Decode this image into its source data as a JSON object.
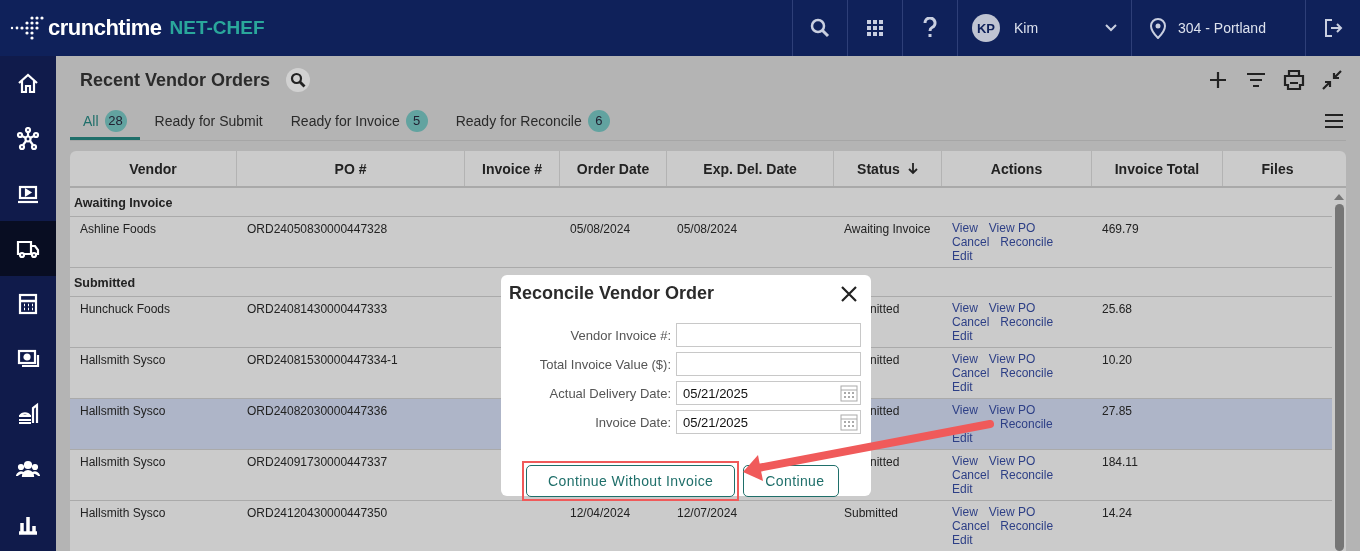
{
  "top_bar": {
    "logo": {
      "brand": "crunchtime",
      "product": "NET-CHEF"
    },
    "user": {
      "initials": "KP",
      "name": "Kim"
    },
    "location": "304 - Portland"
  },
  "sidebar": {
    "items": [
      {
        "kind": "home",
        "selected": false
      },
      {
        "kind": "network",
        "selected": false
      },
      {
        "kind": "screen",
        "selected": false
      },
      {
        "kind": "truck",
        "selected": true
      },
      {
        "kind": "calendar",
        "selected": false
      },
      {
        "kind": "money",
        "selected": false
      },
      {
        "kind": "food",
        "selected": false
      },
      {
        "kind": "people",
        "selected": false
      },
      {
        "kind": "chart",
        "selected": false
      }
    ]
  },
  "page": {
    "title": "Recent Vendor Orders"
  },
  "tabs": [
    {
      "label": "All",
      "count": "28",
      "selected": true
    },
    {
      "label": "Ready for Submit",
      "selected": false
    },
    {
      "label": "Ready for Invoice",
      "count": "5",
      "selected": false
    },
    {
      "label": "Ready for Reconcile",
      "count": "6",
      "selected": false
    }
  ],
  "table": {
    "columns": [
      {
        "label": "Vendor"
      },
      {
        "label": "PO #"
      },
      {
        "label": "Invoice #"
      },
      {
        "label": "Order Date"
      },
      {
        "label": "Exp. Del. Date"
      },
      {
        "label": "Status",
        "sorted": true
      },
      {
        "label": "Actions"
      },
      {
        "label": "Invoice Total"
      },
      {
        "label": "Files"
      }
    ],
    "groups": [
      {
        "title": "Awaiting Invoice",
        "rows": [
          {
            "vendor": "Ashline Foods",
            "po": "ORD24050830000447328",
            "order_date": "05/08/2024",
            "exp_date": "05/08/2024",
            "status": "Awaiting Invoice",
            "actions": [
              "View",
              "View PO",
              "Cancel",
              "Reconcile",
              "Edit"
            ],
            "invoice_total": "469.79",
            "selected": false
          }
        ]
      },
      {
        "title": "Submitted",
        "rows": [
          {
            "vendor": "Hunchuck Foods",
            "po": "ORD24081430000447333",
            "status_tail": "nitted",
            "actions": [
              "View",
              "View PO",
              "Cancel",
              "Reconcile",
              "Edit"
            ],
            "invoice_total": "25.68",
            "selected": false
          },
          {
            "vendor": "Hallsmith Sysco",
            "po": "ORD24081530000447334-1",
            "status_tail": "nitted",
            "actions": [
              "View",
              "View PO",
              "Cancel",
              "Reconcile",
              "Edit"
            ],
            "invoice_total": "10.20",
            "selected": false
          },
          {
            "vendor": "Hallsmith Sysco",
            "po": "ORD24082030000447336",
            "status_tail": "nitted",
            "actions": {
              "view": "View",
              "view_po": "View PO",
              "reconcile": "Reconcile",
              "edit": "Edit"
            },
            "invoice_total": "27.85",
            "selected": true
          },
          {
            "vendor": "Hallsmith Sysco",
            "po": "ORD24091730000447337",
            "status_tail": "nitted",
            "actions": [
              "View",
              "View PO",
              "Cancel",
              "Reconcile",
              "Edit"
            ],
            "invoice_total": "184.11",
            "selected": false
          },
          {
            "vendor": "Hallsmith Sysco",
            "po": "ORD24120430000447350",
            "order_date": "12/04/2024",
            "exp_date": "12/07/2024",
            "status": "Submitted",
            "actions": [
              "View",
              "View PO",
              "Cancel",
              "Reconcile",
              "Edit"
            ],
            "invoice_total": "14.24",
            "selected": false
          }
        ]
      }
    ]
  },
  "dialog": {
    "title": "Reconcile Vendor Order",
    "fields": [
      {
        "label": "Vendor Invoice #:",
        "kind": "text"
      },
      {
        "label": "Total Invoice Value ($):",
        "kind": "text"
      },
      {
        "label": "Actual Delivery Date:",
        "kind": "date",
        "value": "05/21/2025"
      },
      {
        "label": "Invoice Date:",
        "kind": "date",
        "value": "05/21/2025"
      }
    ],
    "buttons": [
      {
        "label": "Continue Without Invoice",
        "highlighted": true
      },
      {
        "label": "Continue",
        "highlighted": false
      }
    ]
  }
}
